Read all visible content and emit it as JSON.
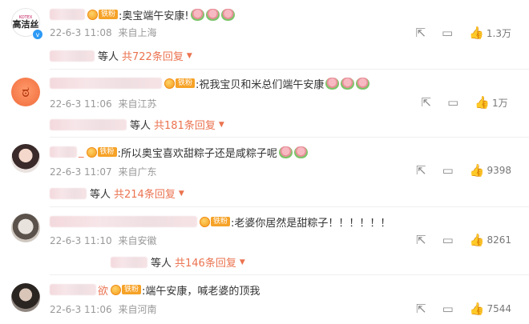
{
  "comments": [
    {
      "avatar_text": "高洁丝",
      "avatar_brand": "KOTEX",
      "text": ":奥宝端午安康!",
      "date": "22-6-3 11:08",
      "location": "来自上海",
      "likes": "1.3万",
      "reply_who": "等人",
      "reply_more": "共722条回复",
      "tag": "铁粉"
    },
    {
      "text": ":祝我宝贝和米总们端午安康",
      "date": "22-6-3 11:06",
      "location": "来自江苏",
      "likes": "1万",
      "reply_who": "等人",
      "reply_more": "共181条回复",
      "tag": "铁粉"
    },
    {
      "name_suffix": "_",
      "text": ":所以奥宝喜欢甜粽子还是咸粽子呢",
      "date": "22-6-3 11:07",
      "location": "来自广东",
      "likes": "9398",
      "reply_who": "等人",
      "reply_more": "共214条回复",
      "tag": "铁粉"
    },
    {
      "text": ":老婆你居然是甜粽子！！！！！！",
      "date": "22-6-3 11:10",
      "location": "来自安徽",
      "likes": "8261",
      "reply_who": "等人",
      "reply_more": "共146条回复",
      "tag": "铁粉"
    },
    {
      "name_suffix": "欲",
      "text": ":端午安康，喊老婆的顶我",
      "date": "22-6-3 11:06",
      "location": "来自河南",
      "likes": "7544",
      "tag": "铁粉"
    }
  ],
  "icons": [
    "share-icon",
    "comment-icon",
    "like-icon",
    "chevron-down-icon"
  ],
  "colors": {
    "reply_accent": "#eb7350",
    "meta_gray": "#999999",
    "tag_orange": "#f6a227"
  }
}
